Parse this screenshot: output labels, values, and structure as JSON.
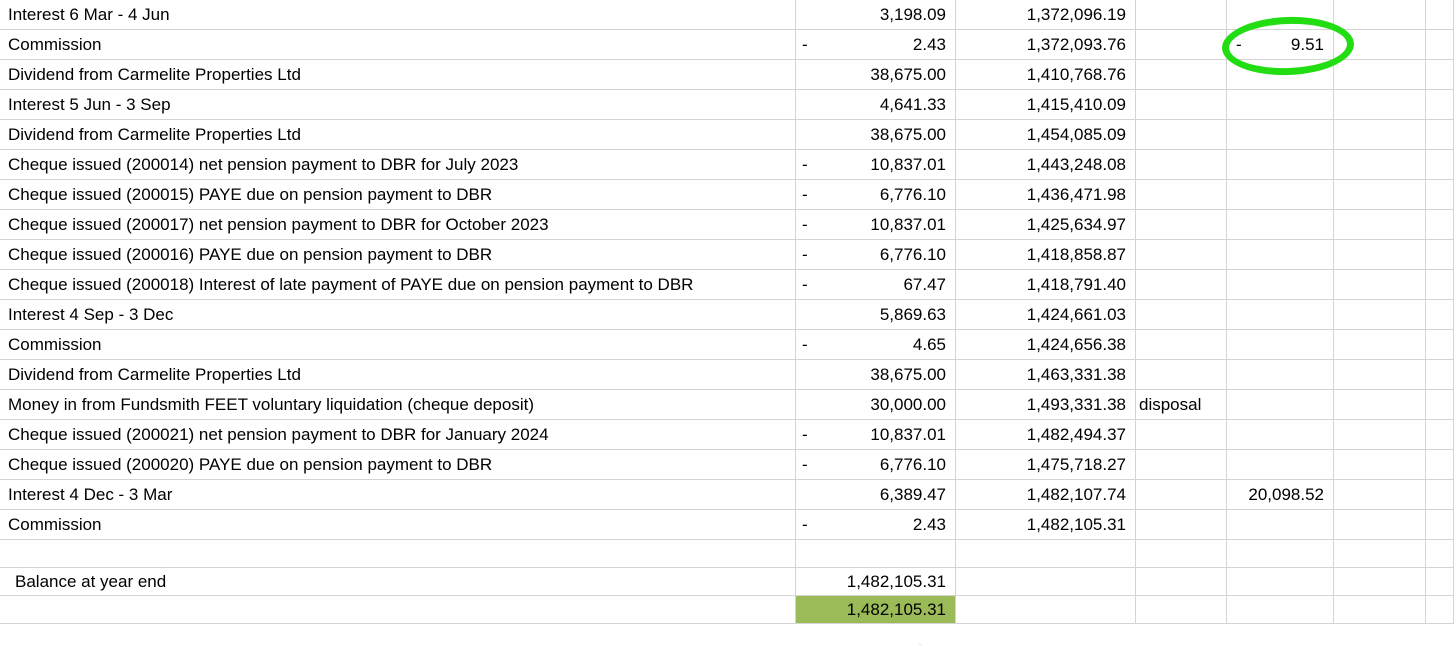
{
  "rows": [
    {
      "desc": "Interest 6 Mar - 4 Jun",
      "neg": "",
      "amount": "3,198.09",
      "balance": "1,372,096.19",
      "note": "",
      "neg2": "",
      "extra": ""
    },
    {
      "desc": "Commission",
      "neg": "-",
      "amount": "2.43",
      "balance": "1,372,093.76",
      "note": "",
      "neg2": "-",
      "extra": "9.51"
    },
    {
      "desc": "Dividend from Carmelite Properties Ltd",
      "neg": "",
      "amount": "38,675.00",
      "balance": "1,410,768.76",
      "note": "",
      "neg2": "",
      "extra": ""
    },
    {
      "desc": "Interest 5 Jun - 3 Sep",
      "neg": "",
      "amount": "4,641.33",
      "balance": "1,415,410.09",
      "note": "",
      "neg2": "",
      "extra": ""
    },
    {
      "desc": "Dividend from Carmelite Properties Ltd",
      "neg": "",
      "amount": "38,675.00",
      "balance": "1,454,085.09",
      "note": "",
      "neg2": "",
      "extra": ""
    },
    {
      "desc": "Cheque issued (200014) net pension payment to DBR for July 2023",
      "neg": "-",
      "amount": "10,837.01",
      "balance": "1,443,248.08",
      "note": "",
      "neg2": "",
      "extra": ""
    },
    {
      "desc": "Cheque issued (200015) PAYE due on pension payment to DBR",
      "neg": "-",
      "amount": "6,776.10",
      "balance": "1,436,471.98",
      "note": "",
      "neg2": "",
      "extra": ""
    },
    {
      "desc": "Cheque issued (200017) net pension payment to DBR for October 2023",
      "neg": "-",
      "amount": "10,837.01",
      "balance": "1,425,634.97",
      "note": "",
      "neg2": "",
      "extra": ""
    },
    {
      "desc": "Cheque issued (200016) PAYE due on pension payment to DBR",
      "neg": "-",
      "amount": "6,776.10",
      "balance": "1,418,858.87",
      "note": "",
      "neg2": "",
      "extra": ""
    },
    {
      "desc": "Cheque issued (200018) Interest of late payment of PAYE due on pension payment to DBR",
      "neg": "-",
      "amount": "67.47",
      "balance": "1,418,791.40",
      "note": "",
      "neg2": "",
      "extra": ""
    },
    {
      "desc": "Interest 4 Sep - 3 Dec",
      "neg": "",
      "amount": "5,869.63",
      "balance": "1,424,661.03",
      "note": "",
      "neg2": "",
      "extra": ""
    },
    {
      "desc": "Commission",
      "neg": "-",
      "amount": "4.65",
      "balance": "1,424,656.38",
      "note": "",
      "neg2": "",
      "extra": ""
    },
    {
      "desc": "Dividend from Carmelite Properties Ltd",
      "neg": "",
      "amount": "38,675.00",
      "balance": "1,463,331.38",
      "note": "",
      "neg2": "",
      "extra": ""
    },
    {
      "desc": "Money in from Fundsmith FEET voluntary liquidation (cheque deposit)",
      "neg": "",
      "amount": "30,000.00",
      "balance": "1,493,331.38",
      "note": "disposal",
      "neg2": "",
      "extra": ""
    },
    {
      "desc": "Cheque issued (200021) net pension payment to DBR for January 2024",
      "neg": "-",
      "amount": "10,837.01",
      "balance": "1,482,494.37",
      "note": "",
      "neg2": "",
      "extra": ""
    },
    {
      "desc": "Cheque issued (200020) PAYE due on pension payment to DBR",
      "neg": "-",
      "amount": "6,776.10",
      "balance": "1,475,718.27",
      "note": "",
      "neg2": "",
      "extra": ""
    },
    {
      "desc": "Interest 4 Dec - 3 Mar",
      "neg": "",
      "amount": "6,389.47",
      "balance": "1,482,107.74",
      "note": "",
      "neg2": "",
      "extra": "20,098.52"
    },
    {
      "desc": "Commission",
      "neg": "-",
      "amount": "2.43",
      "balance": "1,482,105.31",
      "note": "",
      "neg2": "",
      "extra": ""
    }
  ],
  "summary": {
    "balance_label": "Balance at year end",
    "balance_value": "1,482,105.31",
    "check_value": "1,482,105.31",
    "partial_value": "-"
  },
  "highlight_color": "#9bbb59",
  "annotation_color": "#22dd11"
}
